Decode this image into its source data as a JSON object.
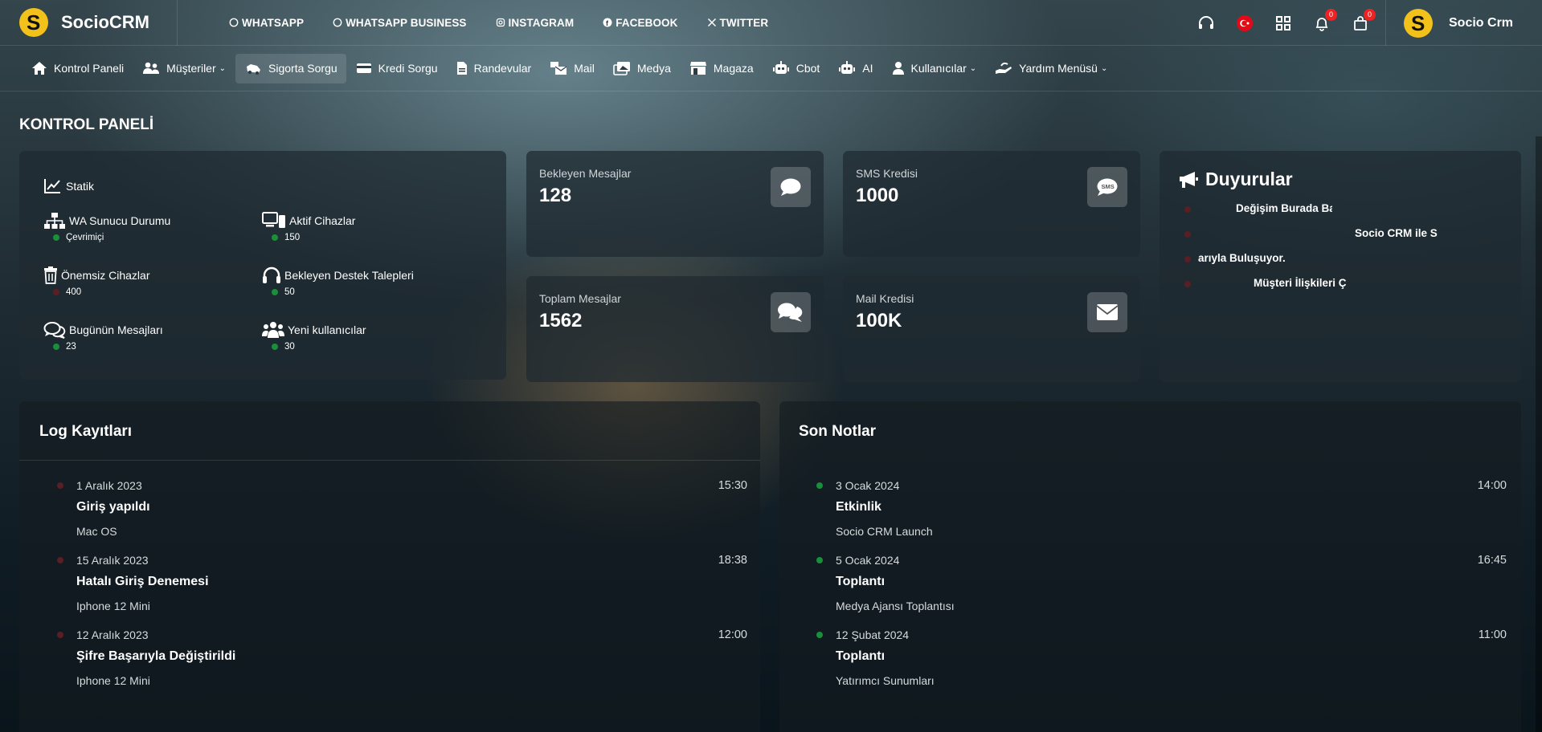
{
  "brand": {
    "name": "SocioCRM"
  },
  "social": [
    {
      "label": "WHATSAPP",
      "icon": "whatsapp-icon"
    },
    {
      "label": "WHATSAPP BUSINESS",
      "icon": "whatsapp-business-icon"
    },
    {
      "label": "INSTAGRAM",
      "icon": "instagram-icon"
    },
    {
      "label": "FACEBOOK",
      "icon": "facebook-icon"
    },
    {
      "label": "TWITTER",
      "icon": "twitter-x-icon"
    }
  ],
  "header": {
    "notifications_count": "0",
    "cart_count": "0",
    "user_name": "Socio Crm"
  },
  "nav": [
    {
      "label": "Kontrol Paneli",
      "icon": "home-icon"
    },
    {
      "label": "Müşteriler",
      "icon": "users-icon",
      "dropdown": true
    },
    {
      "label": "Sigorta Sorgu",
      "icon": "car-crash-icon",
      "active": true
    },
    {
      "label": "Kredi Sorgu",
      "icon": "credit-card-icon"
    },
    {
      "label": "Randevular",
      "icon": "document-icon"
    },
    {
      "label": "Mail",
      "icon": "mail-bulk-icon"
    },
    {
      "label": "Medya",
      "icon": "images-icon"
    },
    {
      "label": "Magaza",
      "icon": "store-icon"
    },
    {
      "label": "Cbot",
      "icon": "robot-icon"
    },
    {
      "label": "AI",
      "icon": "robot-icon"
    },
    {
      "label": "Kullanıcılar",
      "icon": "user-icon",
      "dropdown": true
    },
    {
      "label": "Yardım Menüsü",
      "icon": "hand-holding-icon",
      "dropdown": true
    }
  ],
  "page_title": "KONTROL PANELİ",
  "stats": {
    "title": "Statik",
    "items": [
      {
        "label": "WA Sunucu Durumu",
        "value": "Çevrimiçi",
        "status": "green",
        "icon": "network-icon"
      },
      {
        "label": "Aktif Cihazlar",
        "value": "150",
        "status": "green",
        "icon": "devices-icon"
      },
      {
        "label": "Önemsiz Cihazlar",
        "value": "400",
        "status": "red",
        "icon": "trash-icon"
      },
      {
        "label": "Bekleyen Destek Talepleri",
        "value": "50",
        "status": "green",
        "icon": "headphones-icon"
      },
      {
        "label": "Bugünün Mesajları",
        "value": "23",
        "status": "green",
        "icon": "comments-icon"
      },
      {
        "label": "Yeni kullanıcılar",
        "value": "30",
        "status": "green",
        "icon": "user-group-icon"
      }
    ]
  },
  "metrics": [
    {
      "title": "Bekleyen Mesajlar",
      "value": "128",
      "icon": "comment-icon"
    },
    {
      "title": "SMS Kredisi",
      "value": "1000",
      "icon": "sms-icon"
    },
    {
      "title": "Toplam Mesajlar",
      "value": "1562",
      "icon": "comments-icon"
    },
    {
      "title": "Mail Kredisi",
      "value": "100K",
      "icon": "envelope-icon"
    }
  ],
  "announcements": {
    "title": "Duyurular",
    "items": [
      "Değişim Burada Ba",
      "Socio CRM ile S",
      "arıyla Buluşuyor.",
      "Müşteri İlişkileri Ç"
    ]
  },
  "logs": {
    "title": "Log Kayıtları",
    "items": [
      {
        "date": "1 Aralık 2023",
        "time": "15:30",
        "title": "Giriş yapıldı",
        "sub": "Mac OS"
      },
      {
        "date": "15 Aralık 2023",
        "time": "18:38",
        "title": "Hatalı Giriş Denemesi",
        "sub": "Iphone 12 Mini"
      },
      {
        "date": "12 Aralık 2023",
        "time": "12:00",
        "title": "Şifre Başarıyla Değiştirildi",
        "sub": "Iphone 12 Mini"
      }
    ]
  },
  "notes": {
    "title": "Son Notlar",
    "items": [
      {
        "date": "3 Ocak 2024",
        "time": "14:00",
        "title": "Etkinlik",
        "sub": "Socio CRM Launch"
      },
      {
        "date": "5 Ocak 2024",
        "time": "16:45",
        "title": "Toplantı",
        "sub": "Medya Ajansı Toplantısı"
      },
      {
        "date": "12 Şubat 2024",
        "time": "11:00",
        "title": "Toplantı",
        "sub": "Yatırımcı Sunumları"
      }
    ]
  }
}
